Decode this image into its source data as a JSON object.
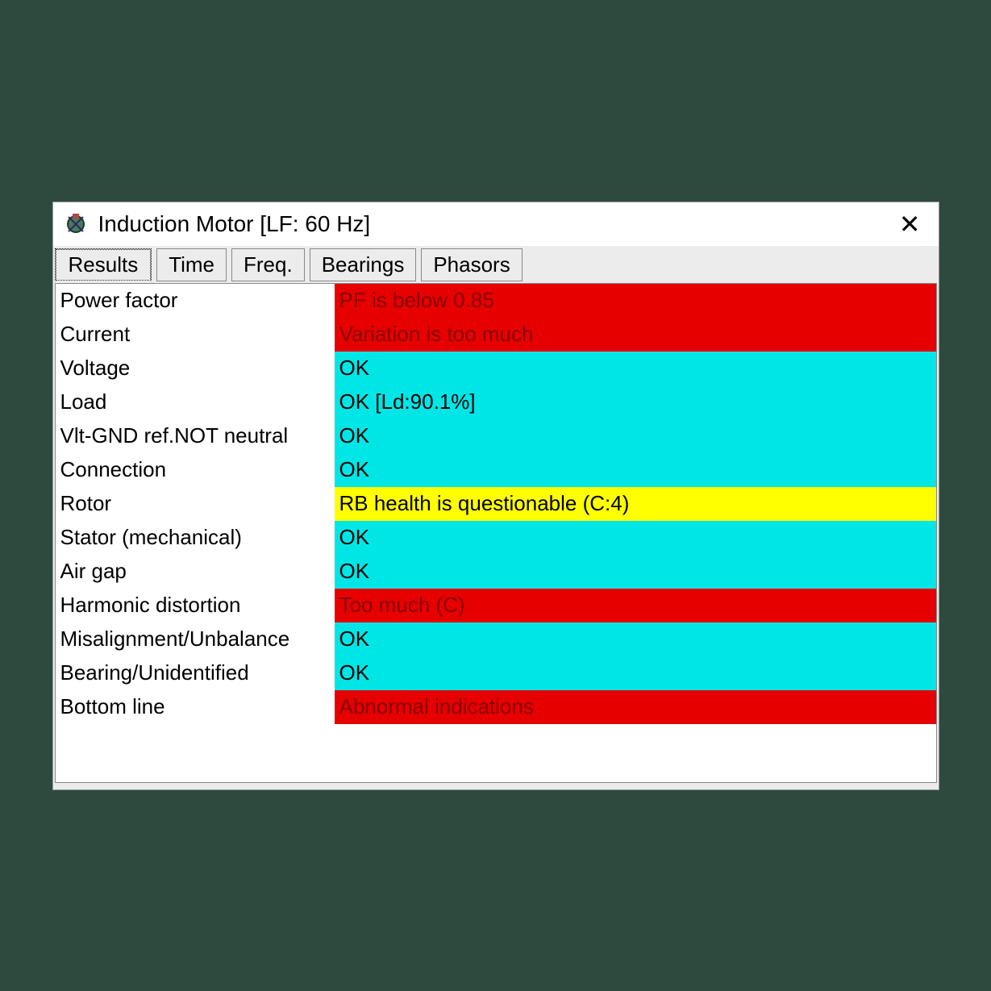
{
  "window": {
    "title": "Induction Motor   [LF: 60 Hz]"
  },
  "tabs": [
    {
      "label": "Results",
      "active": true
    },
    {
      "label": "Time",
      "active": false
    },
    {
      "label": "Freq.",
      "active": false
    },
    {
      "label": "Bearings",
      "active": false
    },
    {
      "label": "Phasors",
      "active": false
    }
  ],
  "results": [
    {
      "label": "Power factor",
      "status": "PF is below 0.85",
      "level": "red"
    },
    {
      "label": "Current",
      "status": "Variation is too much",
      "level": "red"
    },
    {
      "label": "Voltage",
      "status": "OK",
      "level": "cyan"
    },
    {
      "label": "Load",
      "status": "OK [Ld:90.1%]",
      "level": "cyan"
    },
    {
      "label": "Vlt-GND ref.NOT neutral",
      "status": "OK",
      "level": "cyan"
    },
    {
      "label": "Connection",
      "status": "OK",
      "level": "cyan"
    },
    {
      "label": "Rotor",
      "status": "RB health is questionable (C:4)",
      "level": "yellow"
    },
    {
      "label": "Stator (mechanical)",
      "status": "OK",
      "level": "cyan"
    },
    {
      "label": "Air gap",
      "status": "OK",
      "level": "cyan"
    },
    {
      "label": "Harmonic distortion",
      "status": "Too much (C)",
      "level": "red"
    },
    {
      "label": "Misalignment/Unbalance",
      "status": "OK",
      "level": "cyan"
    },
    {
      "label": "Bearing/Unidentified",
      "status": "OK",
      "level": "cyan"
    },
    {
      "label": "Bottom line",
      "status": "Abnormal indications",
      "level": "red"
    }
  ],
  "colors": {
    "red": "#e60000",
    "cyan": "#00e6e6",
    "yellow": "#ffff00"
  }
}
